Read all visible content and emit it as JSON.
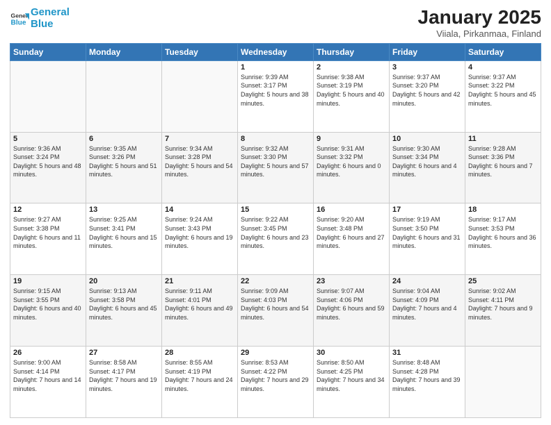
{
  "header": {
    "logo_line1": "General",
    "logo_line2": "Blue",
    "title": "January 2025",
    "subtitle": "Viiala, Pirkanmaa, Finland"
  },
  "weekdays": [
    "Sunday",
    "Monday",
    "Tuesday",
    "Wednesday",
    "Thursday",
    "Friday",
    "Saturday"
  ],
  "weeks": [
    [
      {
        "day": "",
        "info": ""
      },
      {
        "day": "",
        "info": ""
      },
      {
        "day": "",
        "info": ""
      },
      {
        "day": "1",
        "info": "Sunrise: 9:39 AM\nSunset: 3:17 PM\nDaylight: 5 hours and 38 minutes."
      },
      {
        "day": "2",
        "info": "Sunrise: 9:38 AM\nSunset: 3:19 PM\nDaylight: 5 hours and 40 minutes."
      },
      {
        "day": "3",
        "info": "Sunrise: 9:37 AM\nSunset: 3:20 PM\nDaylight: 5 hours and 42 minutes."
      },
      {
        "day": "4",
        "info": "Sunrise: 9:37 AM\nSunset: 3:22 PM\nDaylight: 5 hours and 45 minutes."
      }
    ],
    [
      {
        "day": "5",
        "info": "Sunrise: 9:36 AM\nSunset: 3:24 PM\nDaylight: 5 hours and 48 minutes."
      },
      {
        "day": "6",
        "info": "Sunrise: 9:35 AM\nSunset: 3:26 PM\nDaylight: 5 hours and 51 minutes."
      },
      {
        "day": "7",
        "info": "Sunrise: 9:34 AM\nSunset: 3:28 PM\nDaylight: 5 hours and 54 minutes."
      },
      {
        "day": "8",
        "info": "Sunrise: 9:32 AM\nSunset: 3:30 PM\nDaylight: 5 hours and 57 minutes."
      },
      {
        "day": "9",
        "info": "Sunrise: 9:31 AM\nSunset: 3:32 PM\nDaylight: 6 hours and 0 minutes."
      },
      {
        "day": "10",
        "info": "Sunrise: 9:30 AM\nSunset: 3:34 PM\nDaylight: 6 hours and 4 minutes."
      },
      {
        "day": "11",
        "info": "Sunrise: 9:28 AM\nSunset: 3:36 PM\nDaylight: 6 hours and 7 minutes."
      }
    ],
    [
      {
        "day": "12",
        "info": "Sunrise: 9:27 AM\nSunset: 3:38 PM\nDaylight: 6 hours and 11 minutes."
      },
      {
        "day": "13",
        "info": "Sunrise: 9:25 AM\nSunset: 3:41 PM\nDaylight: 6 hours and 15 minutes."
      },
      {
        "day": "14",
        "info": "Sunrise: 9:24 AM\nSunset: 3:43 PM\nDaylight: 6 hours and 19 minutes."
      },
      {
        "day": "15",
        "info": "Sunrise: 9:22 AM\nSunset: 3:45 PM\nDaylight: 6 hours and 23 minutes."
      },
      {
        "day": "16",
        "info": "Sunrise: 9:20 AM\nSunset: 3:48 PM\nDaylight: 6 hours and 27 minutes."
      },
      {
        "day": "17",
        "info": "Sunrise: 9:19 AM\nSunset: 3:50 PM\nDaylight: 6 hours and 31 minutes."
      },
      {
        "day": "18",
        "info": "Sunrise: 9:17 AM\nSunset: 3:53 PM\nDaylight: 6 hours and 36 minutes."
      }
    ],
    [
      {
        "day": "19",
        "info": "Sunrise: 9:15 AM\nSunset: 3:55 PM\nDaylight: 6 hours and 40 minutes."
      },
      {
        "day": "20",
        "info": "Sunrise: 9:13 AM\nSunset: 3:58 PM\nDaylight: 6 hours and 45 minutes."
      },
      {
        "day": "21",
        "info": "Sunrise: 9:11 AM\nSunset: 4:01 PM\nDaylight: 6 hours and 49 minutes."
      },
      {
        "day": "22",
        "info": "Sunrise: 9:09 AM\nSunset: 4:03 PM\nDaylight: 6 hours and 54 minutes."
      },
      {
        "day": "23",
        "info": "Sunrise: 9:07 AM\nSunset: 4:06 PM\nDaylight: 6 hours and 59 minutes."
      },
      {
        "day": "24",
        "info": "Sunrise: 9:04 AM\nSunset: 4:09 PM\nDaylight: 7 hours and 4 minutes."
      },
      {
        "day": "25",
        "info": "Sunrise: 9:02 AM\nSunset: 4:11 PM\nDaylight: 7 hours and 9 minutes."
      }
    ],
    [
      {
        "day": "26",
        "info": "Sunrise: 9:00 AM\nSunset: 4:14 PM\nDaylight: 7 hours and 14 minutes."
      },
      {
        "day": "27",
        "info": "Sunrise: 8:58 AM\nSunset: 4:17 PM\nDaylight: 7 hours and 19 minutes."
      },
      {
        "day": "28",
        "info": "Sunrise: 8:55 AM\nSunset: 4:19 PM\nDaylight: 7 hours and 24 minutes."
      },
      {
        "day": "29",
        "info": "Sunrise: 8:53 AM\nSunset: 4:22 PM\nDaylight: 7 hours and 29 minutes."
      },
      {
        "day": "30",
        "info": "Sunrise: 8:50 AM\nSunset: 4:25 PM\nDaylight: 7 hours and 34 minutes."
      },
      {
        "day": "31",
        "info": "Sunrise: 8:48 AM\nSunset: 4:28 PM\nDaylight: 7 hours and 39 minutes."
      },
      {
        "day": "",
        "info": ""
      }
    ]
  ]
}
